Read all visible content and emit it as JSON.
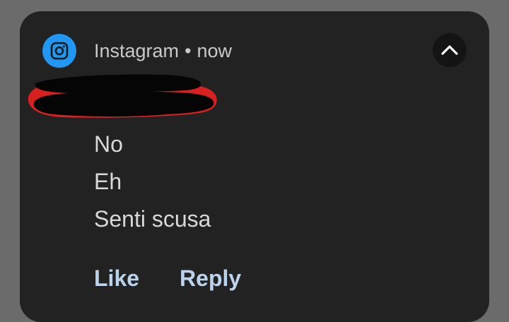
{
  "notification": {
    "app_name": "Instagram",
    "separator": "•",
    "time": "now",
    "app_icon": "instagram-icon",
    "expand_icon": "chevron-up-icon",
    "messages": [
      "No",
      "Eh",
      "Senti scusa"
    ],
    "actions": {
      "like_label": "Like",
      "reply_label": "Reply"
    }
  },
  "colors": {
    "card_background": "#222222",
    "icon_background": "#2196f3",
    "action_text": "#bcd3ec",
    "redaction_outline": "#d92020"
  }
}
